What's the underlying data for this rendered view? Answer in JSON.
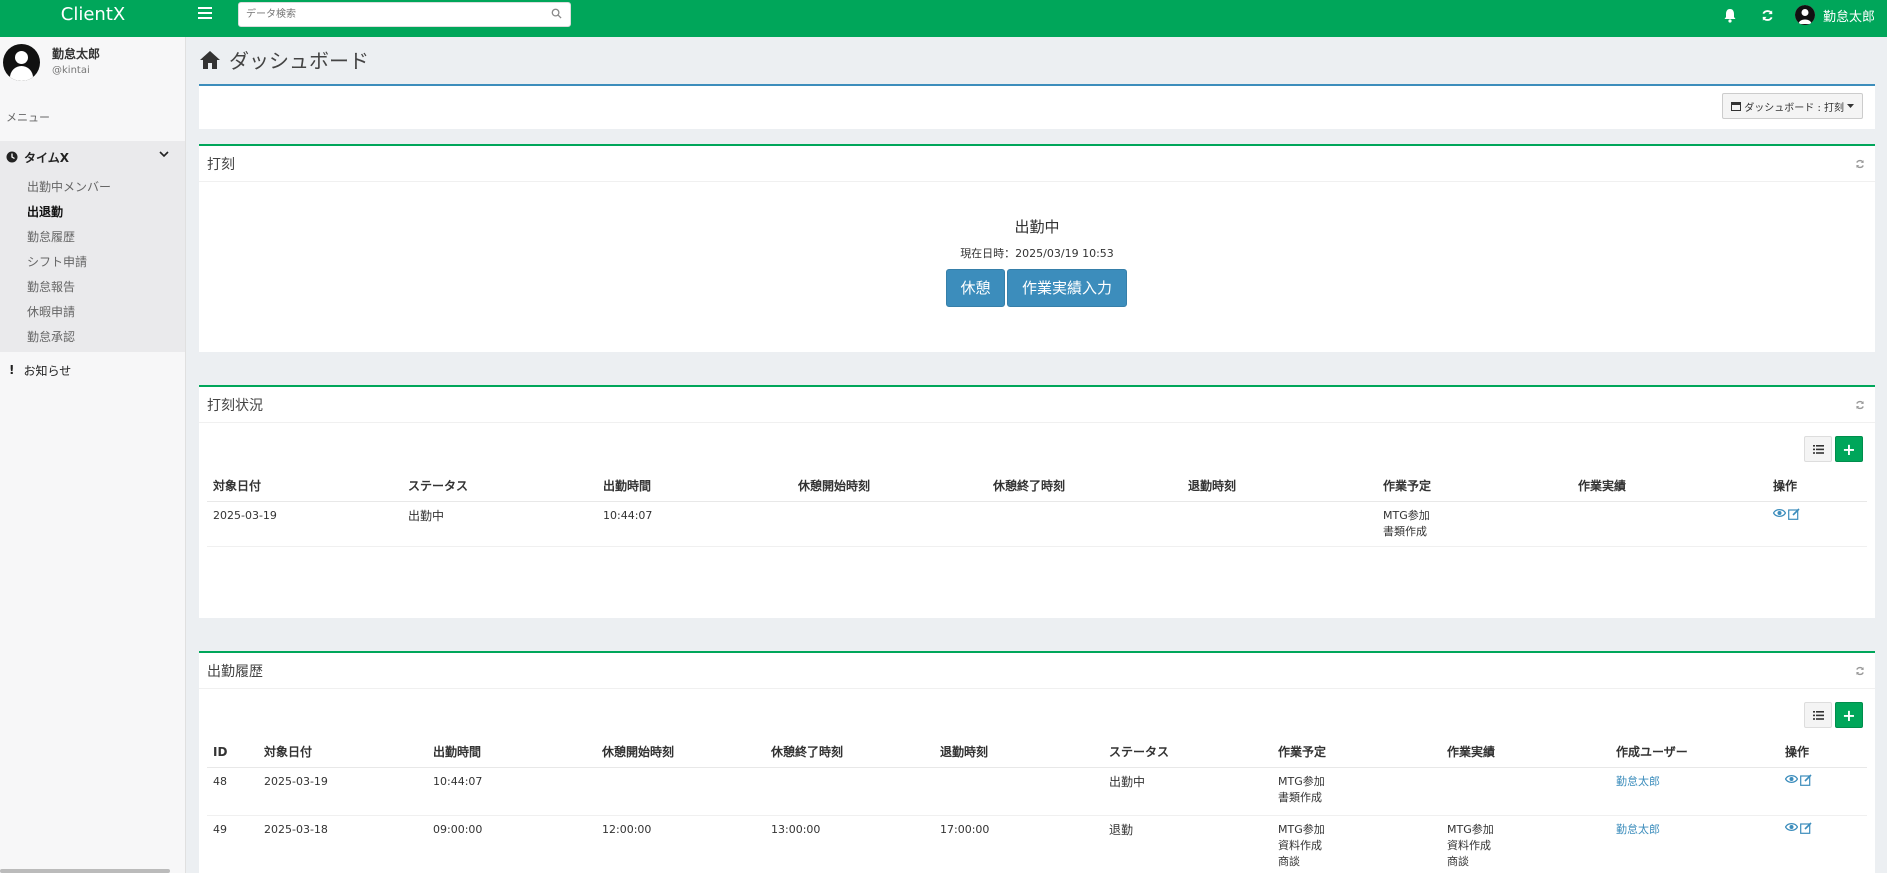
{
  "app": {
    "title": "ClientX"
  },
  "search": {
    "placeholder": "データ検索"
  },
  "topbar": {
    "username": "勤怠太郎"
  },
  "sidebar": {
    "name": "勤怠太郎",
    "handle": "@kintai",
    "menu_label": "メニュー",
    "group": {
      "label": "タイムX",
      "items": [
        {
          "label": "出勤中メンバー"
        },
        {
          "label": "出退勤"
        },
        {
          "label": "勤怠履歴"
        },
        {
          "label": "シフト申請"
        },
        {
          "label": "勤怠報告"
        },
        {
          "label": "休暇申請"
        },
        {
          "label": "勤怠承認"
        }
      ]
    },
    "notice": {
      "label": "お知らせ"
    }
  },
  "page": {
    "title": "ダッシュボード",
    "dropdown_label": "ダッシュボード : 打刻"
  },
  "punch": {
    "title": "打刻",
    "status": "出勤中",
    "datetime": "現在日時：2025/03/19 10:53",
    "break_button": "休憩",
    "work_button": "作業実績入力"
  },
  "punch_status": {
    "title": "打刻状況",
    "headers": [
      "対象日付",
      "ステータス",
      "出勤時間",
      "休憩開始時刻",
      "休憩終了時刻",
      "退勤時刻",
      "作業予定",
      "作業実績",
      "操作"
    ],
    "rows": [
      {
        "date": "2025-03-19",
        "status": "出勤中",
        "start": "10:44:07",
        "break_start": "",
        "break_end": "",
        "end": "",
        "plan": [
          "MTG参加",
          "書類作成"
        ],
        "result": []
      }
    ]
  },
  "history": {
    "title": "出勤履歴",
    "headers": [
      "ID",
      "対象日付",
      "出勤時間",
      "休憩開始時刻",
      "休憩終了時刻",
      "退勤時刻",
      "ステータス",
      "作業予定",
      "作業実績",
      "作成ユーザー",
      "操作"
    ],
    "rows": [
      {
        "id": "48",
        "date": "2025-03-19",
        "start": "10:44:07",
        "break_start": "",
        "break_end": "",
        "end": "",
        "status": "出勤中",
        "plan": [
          "MTG参加",
          "書類作成"
        ],
        "result": [],
        "user": "勤怠太郎"
      },
      {
        "id": "49",
        "date": "2025-03-18",
        "start": "09:00:00",
        "break_start": "12:00:00",
        "break_end": "13:00:00",
        "end": "17:00:00",
        "status": "退勤",
        "plan": [
          "MTG参加",
          "資料作成",
          "商談"
        ],
        "result": [
          "MTG参加",
          "資料作成",
          "商談"
        ],
        "user": "勤怠太郎"
      }
    ]
  },
  "colors": {
    "brand": "#00a65a",
    "accent": "#3c8dbc"
  }
}
